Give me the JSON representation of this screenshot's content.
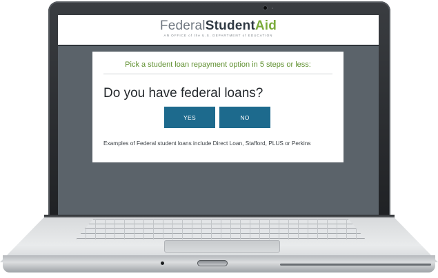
{
  "header": {
    "brand_part1": "Federal",
    "brand_part2": "Student",
    "brand_part3": "Aid",
    "tagline": "AN OFFICE of the U.S. DEPARTMENT of EDUCATION"
  },
  "card": {
    "heading": "Pick a student loan repayment option in 5 steps or less:",
    "question": "Do you have federal loans?",
    "yes_label": "YES",
    "no_label": "NO",
    "examples": "Examples of Federal student loans include Direct Loan, Stafford, PLUS or Perkins"
  },
  "colors": {
    "brand_green": "#7bab3b",
    "heading_green": "#5e8f2e",
    "button_blue": "#1d6a8d",
    "screen_background": "#5b636a"
  }
}
